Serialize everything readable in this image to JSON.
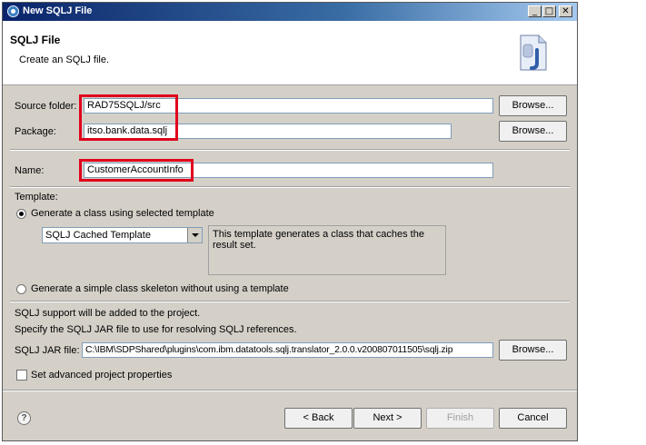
{
  "window": {
    "title": "New SQLJ File",
    "minimize_glyph": "_",
    "maximize_glyph": "□",
    "close_glyph": "✕"
  },
  "header": {
    "title": "SQLJ File",
    "description": "Create an SQLJ file.",
    "icon": "sqlj-file-icon"
  },
  "form": {
    "source_folder": {
      "label": "Source folder:",
      "value": "RAD75SQLJ/src",
      "button": "Browse..."
    },
    "package": {
      "label": "Package:",
      "value": "itso.bank.data.sqlj",
      "button": "Browse..."
    },
    "name": {
      "label": "Name:",
      "value": "CustomerAccountInfo"
    },
    "template": {
      "label": "Template:",
      "option_selected_label": "Generate a class using selected template",
      "selected_template": "SQLJ Cached Template",
      "template_description": "This template generates a class that caches the result set.",
      "option_skeleton_label": "Generate a simple class skeleton without using a template"
    },
    "sqlj_support_note": "SQLJ support will be added to the project.",
    "jar_instruction": "Specify the SQLJ JAR file to use for resolving SQLJ references.",
    "jar_file": {
      "label": "SQLJ JAR file:",
      "value": "C:\\IBM\\SDPShared\\plugins\\com.ibm.datatools.sqlj.translator_2.0.0.v200807011505\\sqlj.zip",
      "button": "Browse..."
    },
    "advanced_checkbox_label": "Set advanced project properties"
  },
  "footer": {
    "help_glyph": "?",
    "back": "< Back",
    "next": "Next >",
    "finish": "Finish",
    "cancel": "Cancel"
  },
  "colors": {
    "highlight": "#e0001b",
    "dialog_bg": "#d4d0c8",
    "titlebar": "#0a246a"
  }
}
